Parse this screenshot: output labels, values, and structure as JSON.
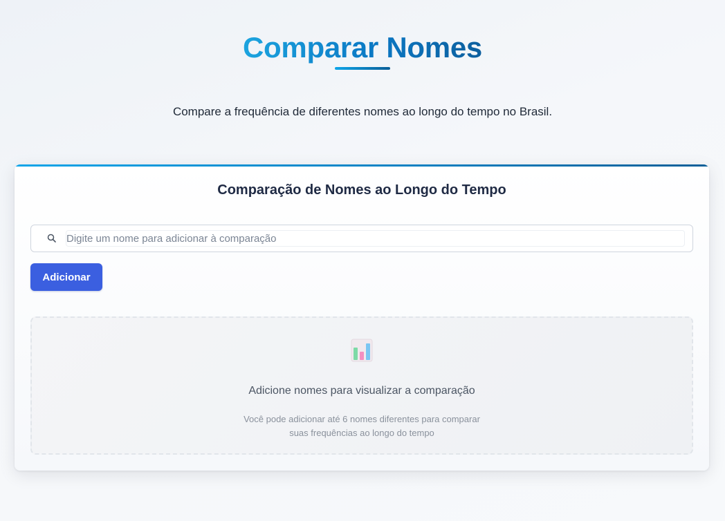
{
  "header": {
    "title": "Comparar Nomes",
    "subtitle": "Compare a frequência de diferentes nomes ao longo do tempo no Brasil."
  },
  "card": {
    "title": "Comparação de Nomes ao Longo do Tempo",
    "search": {
      "placeholder": "Digite um nome para adicionar à comparação",
      "value": "",
      "icon": "search-icon"
    },
    "add_button_label": "Adicionar",
    "empty_state": {
      "icon": "bar-chart-icon",
      "title": "Adicione nomes para visualizar a comparação",
      "description_line1": "Você pode adicionar até 6 nomes diferentes para comparar",
      "description_line2": "suas frequências ao longo do tempo"
    }
  },
  "colors": {
    "accent": "#0ea5e9",
    "accent_dark": "#0b5f98",
    "button": "#3b5fe0"
  }
}
